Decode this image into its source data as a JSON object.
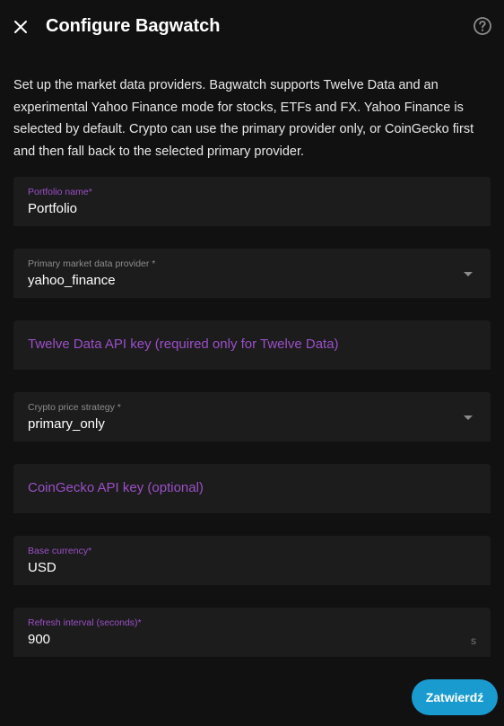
{
  "dialog": {
    "title": "Configure Bagwatch",
    "close_icon": "close-icon",
    "help_icon": "help-circle-icon",
    "description": "Set up the market data providers. Bagwatch supports Twelve Data and an experimental Yahoo Finance mode for stocks, ETFs and FX. Yahoo Finance is selected by default. Crypto can use the primary provider only, or CoinGecko first and then fall back to the selected primary provider."
  },
  "form": {
    "portfolio_name": {
      "label": "Portfolio name*",
      "value": "Portfolio"
    },
    "primary_provider": {
      "label": "Primary market data provider *",
      "value": "yahoo_finance"
    },
    "twelve_data_key": {
      "placeholder": "Twelve Data API key (required only for Twelve Data)",
      "value": ""
    },
    "crypto_strategy": {
      "label": "Crypto price strategy *",
      "value": "primary_only"
    },
    "coingecko_key": {
      "placeholder": "CoinGecko API key (optional)",
      "value": ""
    },
    "base_currency": {
      "label": "Base currency*",
      "value": "USD"
    },
    "refresh_interval": {
      "label": "Refresh interval (seconds)*",
      "value": "900",
      "suffix": "s"
    }
  },
  "actions": {
    "confirm_label": "Zatwierdź"
  },
  "colors": {
    "accent": "#9b4fc7",
    "button": "#1a9bcf",
    "background": "#111111",
    "field": "#1c1c1c"
  }
}
